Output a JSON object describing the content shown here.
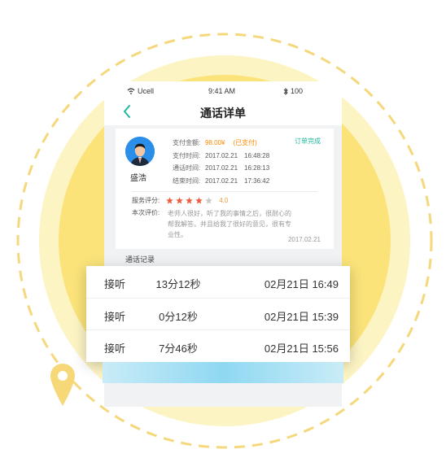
{
  "colors": {
    "circle_fill": "#fbe37a",
    "circle_glow": "#fdf4c4",
    "dash_ring": "#f5d87c",
    "accent_orange": "#ff8a00",
    "accent_teal": "#20b7a0",
    "star_filled": "#f05a3c",
    "star_empty": "#c8c8c8",
    "pin": "#f6d878"
  },
  "statusbar": {
    "carrier": "Ucell",
    "time": "9:41 AM",
    "battery": "100"
  },
  "navbar": {
    "title": "通话详单",
    "back_icon": "chevron-left-icon"
  },
  "card": {
    "name": "盛浩",
    "order_status": "订单完成",
    "rows": [
      {
        "label": "支付金额:",
        "value": "98.00¥",
        "extra": "(已支付)"
      },
      {
        "label": "支付时间:",
        "value": "2017.02.21　16:48:28"
      },
      {
        "label": "通话时间:",
        "value": "2017.02.21　16:28:13"
      },
      {
        "label": "结束时间:",
        "value": "2017.02.21　17:36:42"
      }
    ],
    "rating_label": "服务评分:",
    "rating_value": "4.0",
    "rating_stars": 4,
    "rating_max": 5,
    "eval_label": "本次评价:",
    "eval_text": "老师人很好，听了我的事情之后，很耐心的帮我解答。并且给我了很好的意见，很有专业性。",
    "date": "2017.02.21"
  },
  "records": {
    "header": "通话记录",
    "rows": [
      {
        "type": "接听",
        "duration": "13分12秒",
        "date": "02月21日",
        "time": "16:49"
      },
      {
        "type": "接听",
        "duration": "0分12秒",
        "date": "02月21日",
        "time": "15:39"
      },
      {
        "type": "接听",
        "duration": "7分46秒",
        "date": "02月21日",
        "time": "15:56"
      }
    ]
  }
}
